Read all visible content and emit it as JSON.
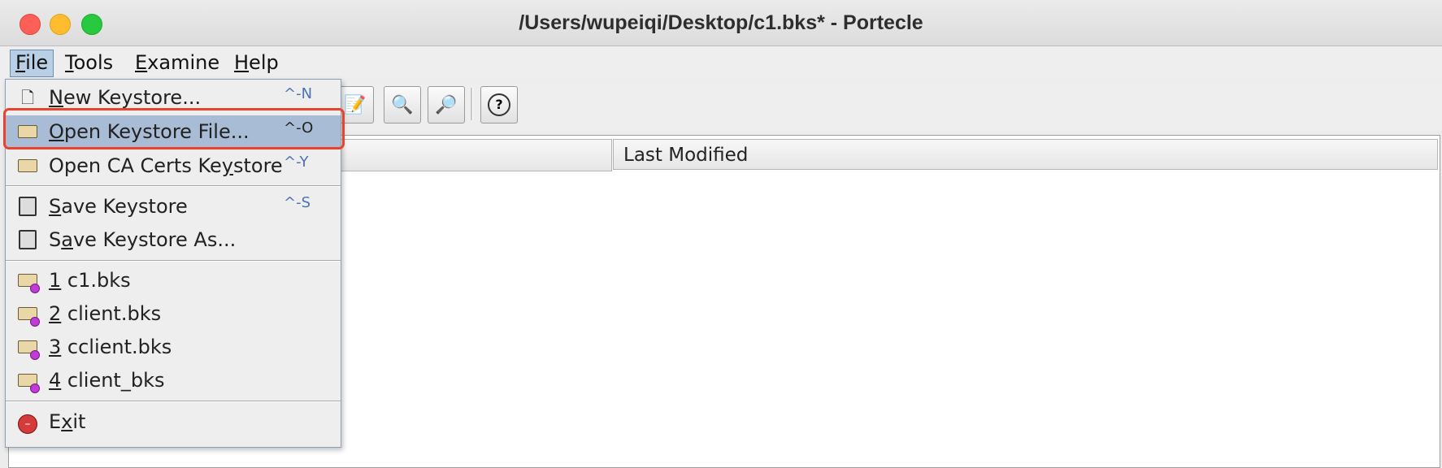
{
  "window": {
    "title": "/Users/wupeiqi/Desktop/c1.bks* - Portecle"
  },
  "menubar": {
    "items": [
      {
        "first": "F",
        "rest": "ile"
      },
      {
        "first": "T",
        "rest": "ools"
      },
      {
        "first": "E",
        "rest": "xamine"
      },
      {
        "first": "H",
        "rest": "elp"
      }
    ]
  },
  "table": {
    "columns": [
      "",
      "Last Modified"
    ]
  },
  "file_menu": {
    "new_keystore": {
      "mnemonic": "N",
      "rest": "ew Keystore...",
      "shortcut": "^-N"
    },
    "open_keystore_file": {
      "mnemonic": "O",
      "rest": "pen Keystore File...",
      "shortcut": "^-O"
    },
    "open_ca_certs": {
      "pre": "Open CA Certs Ke",
      "mnemonic": "y",
      "rest": "store",
      "shortcut": "^-Y"
    },
    "save_keystore": {
      "mnemonic": "S",
      "rest": "ave Keystore",
      "shortcut": "^-S"
    },
    "save_keystore_as": {
      "pre": "S",
      "mnemonic": "a",
      "rest": "ve Keystore As..."
    },
    "recent": [
      {
        "num": "1",
        "name": " c1.bks"
      },
      {
        "num": "2",
        "name": " client.bks"
      },
      {
        "num": "3",
        "name": " cclient.bks"
      },
      {
        "num": "4",
        "name": " client_bks"
      }
    ],
    "exit": {
      "pre": "E",
      "mnemonic": "x",
      "rest": "it"
    }
  },
  "colors": {
    "highlight": "#a8bcd6",
    "annotation": "#e8432f",
    "shortcut": "#4a72b5"
  }
}
